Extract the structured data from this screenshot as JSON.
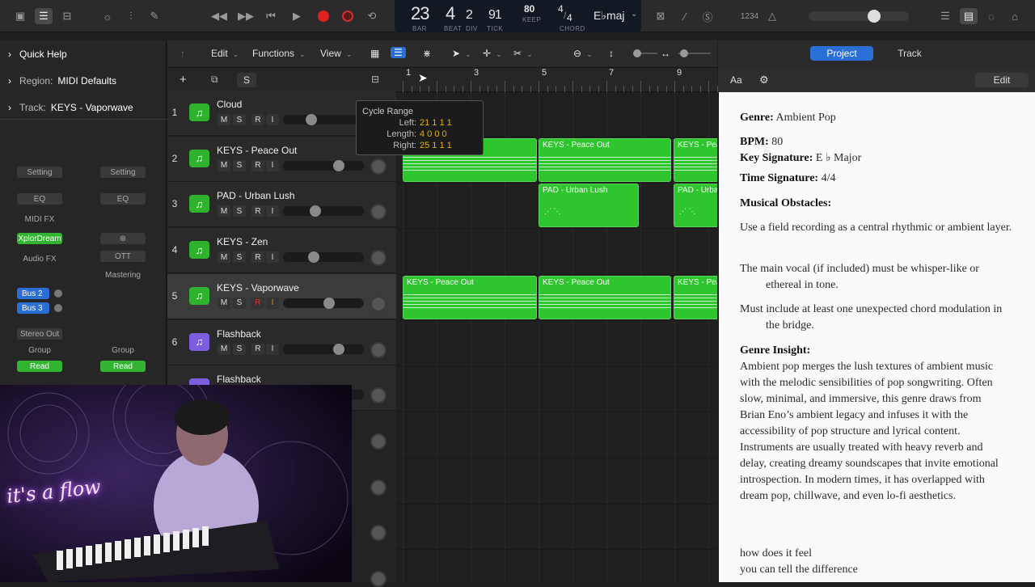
{
  "lcd": {
    "bar": "23",
    "beat": "4",
    "div": "2",
    "tick": "91",
    "labels": [
      "BAR",
      "BEAT",
      "DIV",
      "TICK"
    ],
    "tempo": "80",
    "tempo_label": "KEEP",
    "sig_top": "4",
    "sig_bottom": "4",
    "key": "E♭maj",
    "chord_label": "CHORD"
  },
  "topbar": {
    "counter_label": "1234",
    "master_volume": 0.68
  },
  "inspector": {
    "quick_help": "Quick Help",
    "region_label": "Region:",
    "region_value": "MIDI Defaults",
    "track_label": "Track:",
    "track_value": "KEYS - Vaporwave",
    "col1": {
      "setting": "Setting",
      "eq": "EQ",
      "midi_fx": "MIDI FX",
      "instrument": "XplorDream",
      "audio_fx": "Audio FX",
      "bus2": "Bus 2",
      "bus3": "Bus 3",
      "output": "Stereo Out",
      "group": "Group",
      "automation": "Read"
    },
    "col2": {
      "setting": "Setting",
      "eq": "EQ",
      "plugin": "OTT",
      "output": "Mastering",
      "group": "Group",
      "automation": "Read"
    }
  },
  "toolbar": {
    "edit": "Edit",
    "functions": "Functions",
    "view": "View"
  },
  "track_header": {
    "add": "+",
    "s": "S"
  },
  "tracks": [
    {
      "num": "1",
      "name": "Cloud",
      "fader": 0.32,
      "color": "#2fb32f"
    },
    {
      "num": "2",
      "name": "KEYS - Peace Out",
      "fader": 0.72,
      "color": "#2fb32f"
    },
    {
      "num": "3",
      "name": "PAD - Urban Lush",
      "fader": 0.38,
      "color": "#2fb32f"
    },
    {
      "num": "4",
      "name": "KEYS - Zen",
      "fader": 0.36,
      "color": "#2fb32f"
    },
    {
      "num": "5",
      "name": "KEYS - Vaporwave",
      "fader": 0.58,
      "color": "#2fb32f"
    },
    {
      "num": "6",
      "name": "Flashback",
      "fader": 0.72,
      "color": "#7b5fe0"
    },
    {
      "num": "",
      "name": "Flashback",
      "fader": 0.72,
      "color": "#7b5fe0"
    }
  ],
  "mute_label": "M",
  "solo_label": "S",
  "rec_label": "R",
  "input_label": "I",
  "ruler": {
    "bars": [
      "1",
      "3",
      "5",
      "7",
      "9"
    ]
  },
  "regions": {
    "peace_out": "KEYS - Peace Out",
    "peace_out_short": "KEYS - Pea",
    "urban_lush": "PAD - Urban Lush",
    "urban_lush_short": "PAD - Urba"
  },
  "tooltip": {
    "title": "Cycle Range",
    "left_label": "Left:",
    "left_value": "21 1 1 1",
    "length_label": "Length:",
    "length_value": "4 0 0 0",
    "right_label": "Right:",
    "right_value": "25 1 1 1"
  },
  "right_panel": {
    "tab_project": "Project",
    "tab_track": "Track",
    "font_btn": "Aa",
    "edit": "Edit",
    "genre_label": "Genre:",
    "genre": "Ambient Pop",
    "bpm_label": "BPM:",
    "bpm": "80",
    "key_label": "Key Signature:",
    "key": "E ♭ Major",
    "time_label": "Time Signature:",
    "time": "4/4",
    "obstacles_label": "Musical Obstacles:",
    "obstacle1": "Use a field recording as a central rhythmic or ambient layer.",
    "obstacle2": "The main vocal (if included) must be whisper-like or ethereal in tone.",
    "obstacle3": "Must include at least one unexpected chord modulation in the bridge.",
    "insight_label": "Genre Insight:",
    "insight": "Ambient pop merges the lush textures of ambient music with the melodic sensibilities of pop songwriting. Often slow, minimal, and immersive, this genre draws from Brian Eno’s ambient legacy and infuses it with the accessibility of pop structure and lyrical content. Instruments are usually treated with heavy reverb and delay, creating dreamy soundscapes that invite emotional introspection. In modern times, it has overlapped with dream pop, chillwave, and even lo-fi aesthetics.",
    "lyric1": "how does it feel",
    "lyric2": "you can tell the difference"
  },
  "webcam": {
    "neon_sign": "it's a flow"
  }
}
